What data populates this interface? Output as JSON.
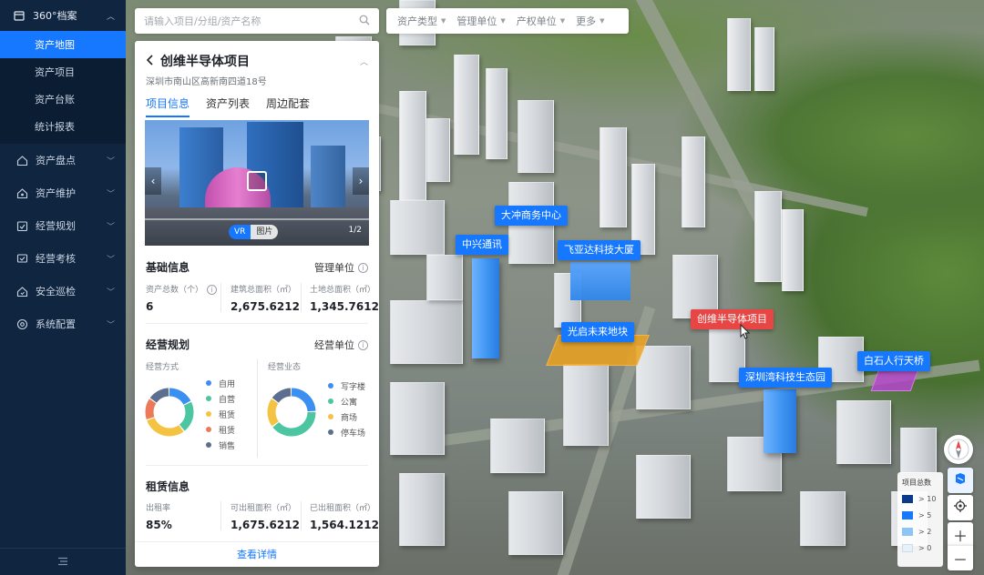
{
  "sidebar": {
    "group_label": "360°档案",
    "sub_items": [
      {
        "label": "资产地图",
        "active": true
      },
      {
        "label": "资产项目",
        "active": false
      },
      {
        "label": "资产台账",
        "active": false
      },
      {
        "label": "统计报表",
        "active": false
      }
    ],
    "items": [
      {
        "label": "资产盘点",
        "icon": "home-icon"
      },
      {
        "label": "资产维护",
        "icon": "wrench-house-icon"
      },
      {
        "label": "经营规划",
        "icon": "plan-icon"
      },
      {
        "label": "经营考核",
        "icon": "review-icon"
      },
      {
        "label": "安全巡检",
        "icon": "shield-home-icon"
      },
      {
        "label": "系统配置",
        "icon": "settings-icon"
      }
    ],
    "collapse_icon": "menu-collapse-icon"
  },
  "search": {
    "placeholder": "请输入项目/分组/资产名称"
  },
  "filters": [
    "资产类型",
    "管理单位",
    "产权单位",
    "更多"
  ],
  "panel": {
    "title": "创维半导体项目",
    "address": "深圳市南山区高新南四道18号",
    "tabs": [
      "项目信息",
      "资产列表",
      "周边配套"
    ],
    "active_tab": 0,
    "photo": {
      "switch_on": "VR",
      "switch_off": "图片",
      "counter": "1/2"
    },
    "basic": {
      "title": "基础信息",
      "right_label": "管理单位",
      "stats": [
        {
          "label": "资产总数（个）",
          "value": "6"
        },
        {
          "label": "建筑总面积（㎡）",
          "value": "2,675.6212"
        },
        {
          "label": "土地总面积（㎡）",
          "value": "1,345.7612"
        }
      ]
    },
    "planning": {
      "title": "经营规划",
      "right_label": "经营单位",
      "left_caption": "经营方式",
      "right_caption": "经营业态",
      "left_legend": [
        {
          "label": "自用",
          "color": "#3b8ff0"
        },
        {
          "label": "自营",
          "color": "#4cc6a0"
        },
        {
          "label": "租赁",
          "color": "#f5c342"
        },
        {
          "label": "租赁",
          "color": "#ec7a59"
        },
        {
          "label": "销售",
          "color": "#5c6f8e"
        }
      ],
      "right_legend": [
        {
          "label": "写字楼",
          "color": "#3b8ff0"
        },
        {
          "label": "公寓",
          "color": "#4cc6a0"
        },
        {
          "label": "商场",
          "color": "#f5c342"
        },
        {
          "label": "停车场",
          "color": "#5c6f8e"
        }
      ],
      "left_donut": [
        18,
        22,
        30,
        15,
        15
      ],
      "right_donut": [
        25,
        40,
        20,
        15
      ]
    },
    "lease": {
      "title": "租赁信息",
      "stats": [
        {
          "label": "出租率",
          "value": "85%"
        },
        {
          "label": "可出租面积（㎡）",
          "value": "1,675.6212"
        },
        {
          "label": "已出租面积（㎡）",
          "value": "1,564.1212"
        }
      ]
    },
    "footer_link": "查看详情"
  },
  "map_labels": [
    {
      "text": "大冲商务中心",
      "type": "blue"
    },
    {
      "text": "中兴通讯",
      "type": "blue"
    },
    {
      "text": "飞亚达科技大厦",
      "type": "blue"
    },
    {
      "text": "光启未来地块",
      "type": "blue"
    },
    {
      "text": "创维半导体项目",
      "type": "red"
    },
    {
      "text": "深圳湾科技生态园",
      "type": "blue"
    },
    {
      "text": "白石人行天桥",
      "type": "blue"
    }
  ],
  "map_legend": {
    "title": "项目总数",
    "rows": [
      {
        "label": "> 10",
        "color": "#0b3a8a"
      },
      {
        "label": "> 5",
        "color": "#1677ff"
      },
      {
        "label": "> 2",
        "color": "#8ec5f5"
      },
      {
        "label": "> 0",
        "color": "#e6f1fc"
      }
    ]
  },
  "map_controls": [
    "compass-icon",
    "layers-icon",
    "locate-icon",
    "zoom-in-icon",
    "zoom-out-icon"
  ],
  "colors": {
    "accent": "#1677ff",
    "sidebar_bg": "#0f2540",
    "highlight_red": "#e84545"
  }
}
